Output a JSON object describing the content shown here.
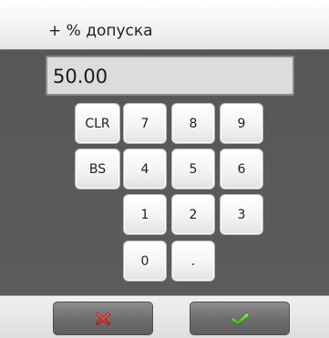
{
  "dialog": {
    "title": "+ % допуска"
  },
  "input": {
    "value": "50.00"
  },
  "keypad": {
    "keys": [
      "CLR",
      "7",
      "8",
      "9",
      "BS",
      "4",
      "5",
      "6",
      "1",
      "2",
      "3",
      "0",
      "."
    ]
  },
  "footer": {
    "cancel_icon": "x-icon",
    "confirm_icon": "checkmark-icon",
    "cancel_color": "#e8322b",
    "confirm_color": "#5fbf3a"
  }
}
